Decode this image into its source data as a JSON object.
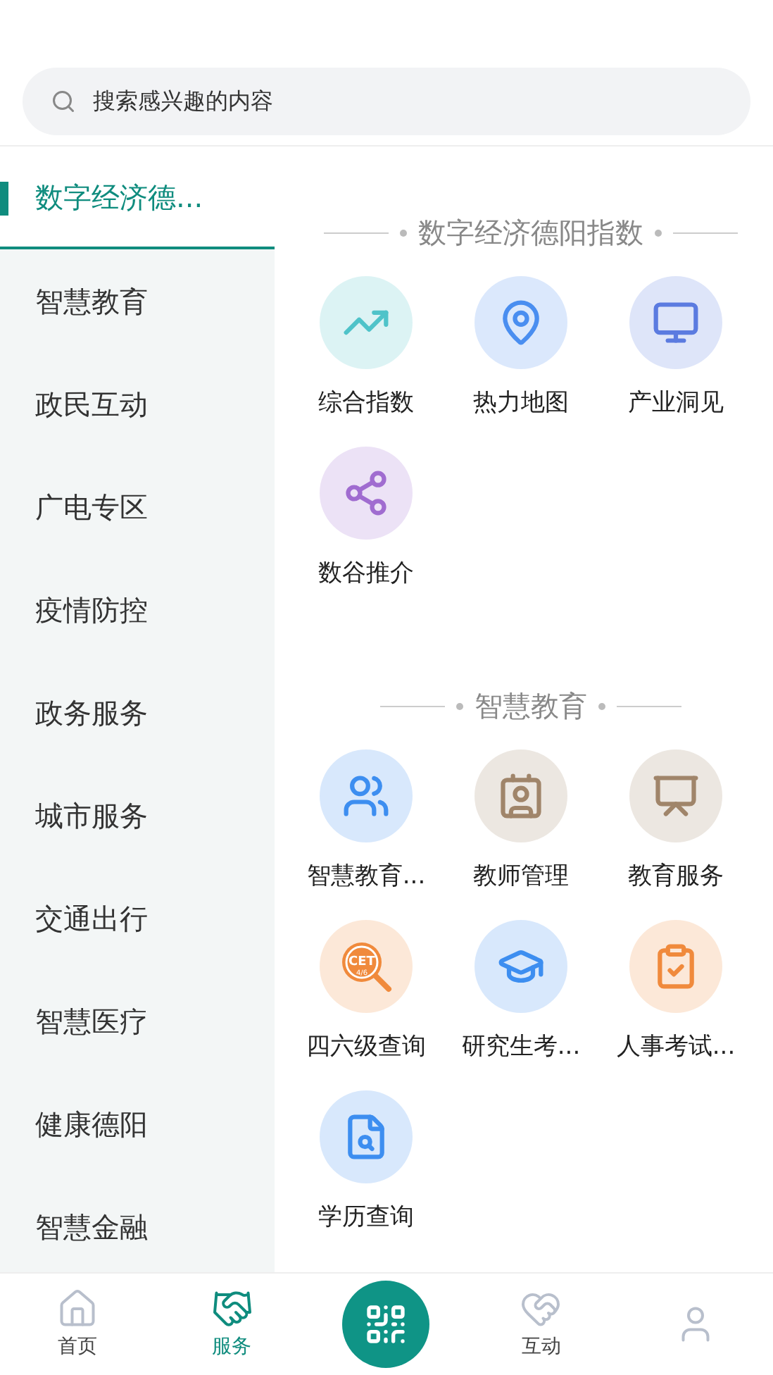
{
  "search": {
    "placeholder": "搜索感兴趣的内容"
  },
  "sidebar": {
    "items": [
      {
        "label": "数字经济德...",
        "selected": true
      },
      {
        "label": "智慧教育",
        "selected": false
      },
      {
        "label": "政民互动",
        "selected": false
      },
      {
        "label": "广电专区",
        "selected": false
      },
      {
        "label": "疫情防控",
        "selected": false
      },
      {
        "label": "政务服务",
        "selected": false
      },
      {
        "label": "城市服务",
        "selected": false
      },
      {
        "label": "交通出行",
        "selected": false
      },
      {
        "label": "智慧医疗",
        "selected": false
      },
      {
        "label": "健康德阳",
        "selected": false
      },
      {
        "label": "智慧金融",
        "selected": false
      }
    ]
  },
  "sections": [
    {
      "title": "数字经济德阳指数",
      "items": [
        {
          "label": "综合指数",
          "kind": "chart",
          "color": "#4fc3c9"
        },
        {
          "label": "热力地图",
          "kind": "map",
          "color": "#4a8ef0"
        },
        {
          "label": "产业洞见",
          "kind": "monitor",
          "color": "#5b7be0"
        },
        {
          "label": "数谷推介",
          "kind": "network",
          "color": "#a06cd0"
        }
      ]
    },
    {
      "title": "智慧教育",
      "items": [
        {
          "label": "智慧教育...",
          "kind": "family",
          "color": "#3d8ef0"
        },
        {
          "label": "教师管理",
          "kind": "card",
          "color": "#a0856a"
        },
        {
          "label": "教育服务",
          "kind": "lecture",
          "color": "#a0856a"
        },
        {
          "label": "四六级查询",
          "kind": "cet",
          "color": "#f08a3c",
          "icon_text": [
            "CET",
            "4/6"
          ]
        },
        {
          "label": "研究生考...",
          "kind": "graduate",
          "color": "#3d8ef0"
        },
        {
          "label": "人事考试...",
          "kind": "exam",
          "color": "#f08a3c"
        },
        {
          "label": "学历查询",
          "kind": "degree",
          "color": "#3d8ef0"
        }
      ]
    }
  ],
  "tabbar": [
    {
      "label": "首页",
      "kind": "home",
      "selected": false
    },
    {
      "label": "服务",
      "kind": "handshake",
      "selected": true
    },
    {
      "kind": "scan",
      "selected": false
    },
    {
      "label": "互动",
      "kind": "heart",
      "selected": false
    },
    {
      "kind": "user",
      "selected": false
    }
  ]
}
